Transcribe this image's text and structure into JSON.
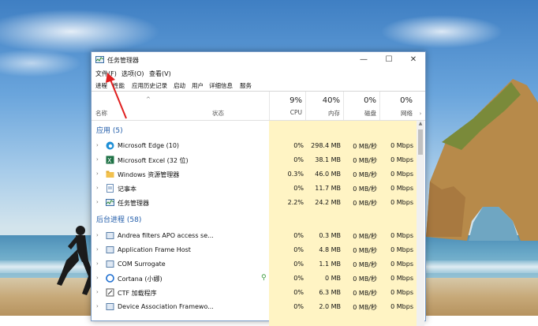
{
  "window": {
    "title": "任务管理器"
  },
  "window_controls": {
    "minimize": "—",
    "maximize": "☐",
    "close": "✕"
  },
  "menu": [
    "文件(F)",
    "选项(O)",
    "查看(V)"
  ],
  "tabs": [
    "进程",
    "性能",
    "应用历史记录",
    "启动",
    "用户",
    "详细信息",
    "服务"
  ],
  "columns": {
    "name": "名称",
    "status": "状态",
    "cpu": {
      "pct": "9%",
      "label": "CPU"
    },
    "memory": {
      "pct": "40%",
      "label": "内存"
    },
    "disk": {
      "pct": "0%",
      "label": "磁盘"
    },
    "network": {
      "pct": "0%",
      "label": "网络"
    }
  },
  "groups": {
    "apps": "应用 (5)",
    "background": "后台进程 (58)"
  },
  "apps": [
    {
      "name": "Microsoft Edge (10)",
      "icon": "edge-icon",
      "cpu": "0%",
      "memory": "298.4 MB",
      "disk": "0 MB/秒",
      "network": "0 Mbps"
    },
    {
      "name": "Microsoft Excel (32 位)",
      "icon": "excel-icon",
      "cpu": "0%",
      "memory": "38.1 MB",
      "disk": "0 MB/秒",
      "network": "0 Mbps"
    },
    {
      "name": "Windows 资源管理器",
      "icon": "folder-icon",
      "cpu": "0.3%",
      "memory": "46.0 MB",
      "disk": "0 MB/秒",
      "network": "0 Mbps"
    },
    {
      "name": "记事本",
      "icon": "notepad-icon",
      "cpu": "0%",
      "memory": "11.7 MB",
      "disk": "0 MB/秒",
      "network": "0 Mbps"
    },
    {
      "name": "任务管理器",
      "icon": "task-manager-icon",
      "cpu": "2.2%",
      "memory": "24.2 MB",
      "disk": "0 MB/秒",
      "network": "0 Mbps"
    }
  ],
  "background": [
    {
      "name": "Andrea filters APO access se...",
      "icon": "service-icon",
      "cpu": "0%",
      "memory": "0.3 MB",
      "disk": "0 MB/秒",
      "network": "0 Mbps"
    },
    {
      "name": "Application Frame Host",
      "icon": "app-frame-icon",
      "cpu": "0%",
      "memory": "4.8 MB",
      "disk": "0 MB/秒",
      "network": "0 Mbps"
    },
    {
      "name": "COM Surrogate",
      "icon": "com-icon",
      "cpu": "0%",
      "memory": "1.1 MB",
      "disk": "0 MB/秒",
      "network": "0 Mbps"
    },
    {
      "name": "Cortana (小娜)",
      "icon": "cortana-icon",
      "cpu": "0%",
      "memory": "0 MB",
      "disk": "0 MB/秒",
      "network": "0 Mbps",
      "status_icon": "leaf-icon"
    },
    {
      "name": "CTF 加载程序",
      "icon": "ctf-icon",
      "cpu": "0%",
      "memory": "6.3 MB",
      "disk": "0 MB/秒",
      "network": "0 Mbps"
    },
    {
      "name": "Device Association Framewo...",
      "icon": "device-icon",
      "cpu": "0%",
      "memory": "2.0 MB",
      "disk": "0 MB/秒",
      "network": "0 Mbps"
    }
  ]
}
